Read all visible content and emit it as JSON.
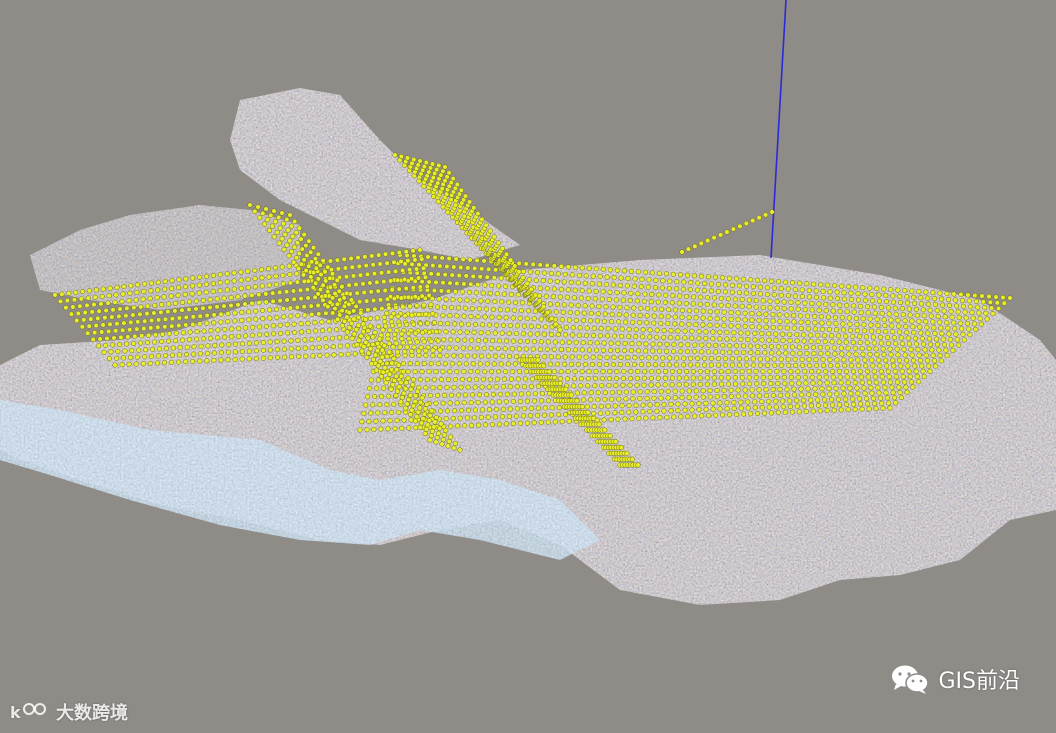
{
  "watermark_left": {
    "text": "大数跨境",
    "icon": "kuajing-logo-icon"
  },
  "watermark_right": {
    "text": "GIS前沿",
    "icon": "wechat-icon"
  },
  "colors": {
    "background": "#8f8b87",
    "camera_points": "#e8ee2a",
    "axis": "#2a2ad8"
  }
}
